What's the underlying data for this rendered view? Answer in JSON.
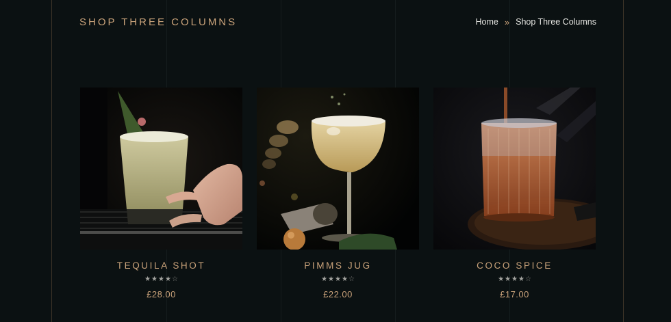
{
  "header": {
    "page_title": "SHOP THREE COLUMNS",
    "breadcrumb": {
      "home": "Home",
      "separator": "»",
      "current": "Shop Three Columns"
    }
  },
  "colors": {
    "background": "#0b1112",
    "accent_gold": "#c9a27a",
    "text_light": "#e6e6e2"
  },
  "products": [
    {
      "name": "TEQUILA SHOT",
      "rating": 4,
      "rating_max": 5,
      "price": "£28.00",
      "image": "cocktail-tequila-shot-image"
    },
    {
      "name": "PIMMS JUG",
      "rating": 4,
      "rating_max": 5,
      "price": "£22.00",
      "image": "cocktail-pimms-jug-image"
    },
    {
      "name": "COCO SPICE",
      "rating": 4,
      "rating_max": 5,
      "price": "£17.00",
      "image": "cocktail-coco-spice-image"
    }
  ]
}
